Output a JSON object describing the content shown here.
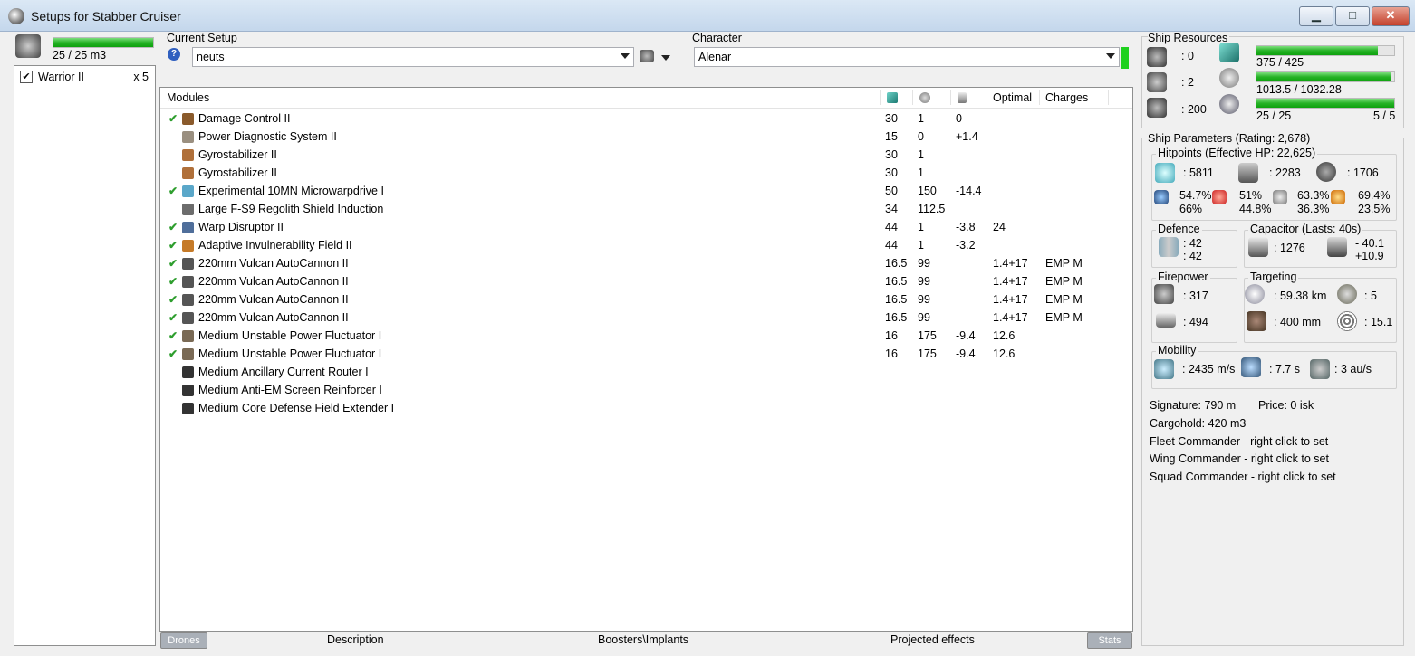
{
  "window": {
    "title": "Setups for Stabber Cruiser",
    "minimize": "▁",
    "maximize": "□",
    "close": "✕"
  },
  "drones": {
    "bay_value": "25 / 25 m3",
    "bay_fill": 1.0,
    "items": [
      {
        "name": "Warrior II",
        "count": "x 5",
        "checked": true
      }
    ]
  },
  "setup": {
    "label": "Current Setup",
    "value": "neuts",
    "help_icon": "?"
  },
  "character": {
    "label": "Character",
    "value": "Alenar"
  },
  "modules": {
    "headers": {
      "name": "Modules",
      "optimal": "Optimal",
      "charges": "Charges"
    },
    "rows": [
      {
        "check": "✔",
        "name": "Damage Control II",
        "cpu": "30",
        "pg": "1",
        "cap": "0",
        "optimal": "",
        "charges": "",
        "color": "#8a5a2b"
      },
      {
        "check": "",
        "name": "Power Diagnostic System II",
        "cpu": "15",
        "pg": "0",
        "cap": "+1.4",
        "optimal": "",
        "charges": "",
        "color": "#9a8f80"
      },
      {
        "check": "",
        "name": "Gyrostabilizer II",
        "cpu": "30",
        "pg": "1",
        "cap": "",
        "optimal": "",
        "charges": "",
        "color": "#b0703a"
      },
      {
        "check": "",
        "name": "Gyrostabilizer II",
        "cpu": "30",
        "pg": "1",
        "cap": "",
        "optimal": "",
        "charges": "",
        "color": "#b0703a"
      },
      {
        "check": "✔",
        "name": "Experimental 10MN Microwarpdrive I",
        "cpu": "50",
        "pg": "150",
        "cap": "-14.4",
        "optimal": "",
        "charges": "",
        "color": "#5aa7c9"
      },
      {
        "check": "",
        "name": "Large F-S9 Regolith Shield Induction",
        "cpu": "34",
        "pg": "112.5",
        "cap": "",
        "optimal": "",
        "charges": "",
        "color": "#6c6c6c"
      },
      {
        "check": "✔",
        "name": "Warp Disruptor II",
        "cpu": "44",
        "pg": "1",
        "cap": "-3.8",
        "optimal": "24",
        "charges": "",
        "color": "#4f6e9a"
      },
      {
        "check": "✔",
        "name": "Adaptive Invulnerability Field II",
        "cpu": "44",
        "pg": "1",
        "cap": "-3.2",
        "optimal": "",
        "charges": "",
        "color": "#c57a28"
      },
      {
        "check": "✔",
        "name": "220mm Vulcan AutoCannon II",
        "cpu": "16.5",
        "pg": "99",
        "cap": "",
        "optimal": "1.4+17",
        "charges": "EMP M",
        "color": "#555"
      },
      {
        "check": "✔",
        "name": "220mm Vulcan AutoCannon II",
        "cpu": "16.5",
        "pg": "99",
        "cap": "",
        "optimal": "1.4+17",
        "charges": "EMP M",
        "color": "#555"
      },
      {
        "check": "✔",
        "name": "220mm Vulcan AutoCannon II",
        "cpu": "16.5",
        "pg": "99",
        "cap": "",
        "optimal": "1.4+17",
        "charges": "EMP M",
        "color": "#555"
      },
      {
        "check": "✔",
        "name": "220mm Vulcan AutoCannon II",
        "cpu": "16.5",
        "pg": "99",
        "cap": "",
        "optimal": "1.4+17",
        "charges": "EMP M",
        "color": "#555"
      },
      {
        "check": "✔",
        "name": "Medium Unstable Power Fluctuator I",
        "cpu": "16",
        "pg": "175",
        "cap": "-9.4",
        "optimal": "12.6",
        "charges": "",
        "color": "#7a6a55"
      },
      {
        "check": "✔",
        "name": "Medium Unstable Power Fluctuator I",
        "cpu": "16",
        "pg": "175",
        "cap": "-9.4",
        "optimal": "12.6",
        "charges": "",
        "color": "#7a6a55"
      },
      {
        "check": "",
        "name": "Medium Ancillary Current Router I",
        "cpu": "",
        "pg": "",
        "cap": "",
        "optimal": "",
        "charges": "",
        "color": "#333"
      },
      {
        "check": "",
        "name": "Medium Anti-EM Screen Reinforcer I",
        "cpu": "",
        "pg": "",
        "cap": "",
        "optimal": "",
        "charges": "",
        "color": "#333"
      },
      {
        "check": "",
        "name": "Medium Core Defense Field Extender I",
        "cpu": "",
        "pg": "",
        "cap": "",
        "optimal": "",
        "charges": "",
        "color": "#333"
      }
    ]
  },
  "tabs": {
    "drones": "Drones",
    "description": "Description",
    "boosters": "Boosters\\Implants",
    "projected": "Projected effects",
    "stats": "Stats"
  },
  "resources": {
    "title": "Ship Resources",
    "turret": ": 0",
    "launcher": ": 2",
    "calibration": ": 200",
    "cpu": {
      "text": "375 / 425",
      "fill": 0.882
    },
    "pg": {
      "text": "1013.5 / 1032.28",
      "fill": 0.982
    },
    "bandwidth": {
      "text": "25 / 25",
      "drones": "5 / 5",
      "fill": 1.0
    }
  },
  "params": {
    "title": "Ship Parameters (Rating: 2,678)",
    "hitpoints": {
      "title": "Hitpoints (Effective HP: 22,625)",
      "shield": ": 5811",
      "armor": ": 2283",
      "structure": ": 1706",
      "em": [
        "54.7%",
        "66%"
      ],
      "thermal": [
        "51%",
        "44.8%"
      ],
      "kinetic": [
        "63.3%",
        "36.3%"
      ],
      "explosive": [
        "69.4%",
        "23.5%"
      ]
    },
    "defence": {
      "title": "Defence",
      "a": ": 42",
      "b": ": 42"
    },
    "capacitor": {
      "title": "Capacitor (Lasts: 40s)",
      "amount": ": 1276",
      "a": "- 40.1",
      "b": "+10.9"
    },
    "firepower": {
      "title": "Firepower",
      "turret": ": 317",
      "volley": ": 494"
    },
    "targeting": {
      "title": "Targeting",
      "range": ": 59.38 km",
      "targets": ": 5",
      "scan_res": ": 400 mm",
      "sensor": ": 15.1"
    },
    "mobility": {
      "title": "Mobility",
      "speed": ": 2435 m/s",
      "align": ": 7.7 s",
      "warp": ": 3 au/s"
    }
  },
  "info": {
    "signature": "Signature: 790 m",
    "price": "Price: 0 isk",
    "cargo": "Cargohold: 420 m3",
    "fleet": "Fleet Commander - right click to set",
    "wing": "Wing Commander - right click to set",
    "squad": "Squad Commander - right click to set"
  }
}
